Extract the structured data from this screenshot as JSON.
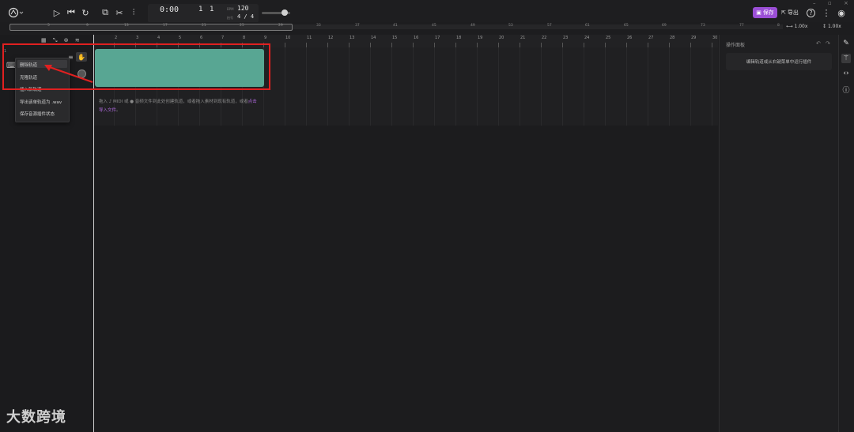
{
  "window": {
    "controls": [
      "–",
      "▫",
      "×"
    ]
  },
  "toolbar": {
    "logo_icon": "logo-icon",
    "play_icon": "▷",
    "stop_icon": "⏮",
    "loop_icon": "↻",
    "crop_icon": "⧉",
    "cut_icon": "✂",
    "mixer_icon": "⫶"
  },
  "transport": {
    "time": "0:00",
    "time_sub": "",
    "bar": "1",
    "beat": "1",
    "bpm": "120",
    "signature": "4 / 4",
    "bpm_label": "BPM",
    "sig_label": "拍号"
  },
  "header_right": {
    "save_label": "保存",
    "export_label": "导出",
    "help_icon": "?",
    "more_icon": "⋮",
    "user_icon": "◉"
  },
  "overview": {
    "numbers": [
      "5",
      "9",
      "13",
      "17",
      "21",
      "25",
      "29",
      "33",
      "37",
      "41",
      "45",
      "49",
      "53",
      "57",
      "61",
      "65",
      "69",
      "73",
      "77",
      "8"
    ],
    "zoom_h": "1.00x",
    "zoom_v": "1.00x"
  },
  "ruler": {
    "numbers": [
      "2",
      "3",
      "4",
      "5",
      "6",
      "7",
      "8",
      "9",
      "10",
      "11",
      "12",
      "13",
      "14",
      "15",
      "16",
      "17",
      "18",
      "19",
      "20",
      "21",
      "22",
      "23",
      "24",
      "25",
      "26",
      "27",
      "28",
      "29",
      "30"
    ]
  },
  "track": {
    "number": "1",
    "mute_icon": "M"
  },
  "context_menu": {
    "items": [
      "删除轨道",
      "克隆轨道",
      "插入新轨道",
      "导出该单轨道为 .wav",
      "保存音源插件状态"
    ]
  },
  "hint": {
    "line1": "拖入 ♪ MIDI 或 ● 音频文件到此处创建轨道，或者拖入素材到现有轨道，或者",
    "link": "点击导入文件",
    "line2": "。"
  },
  "panel": {
    "title": "操作面板",
    "message": "编辑轨道或从右键菜单中运行插件"
  },
  "watermark": "大数跨境",
  "colors": {
    "accent": "#9b4fd6",
    "clip": "#58a693",
    "highlight": "#e02020"
  }
}
